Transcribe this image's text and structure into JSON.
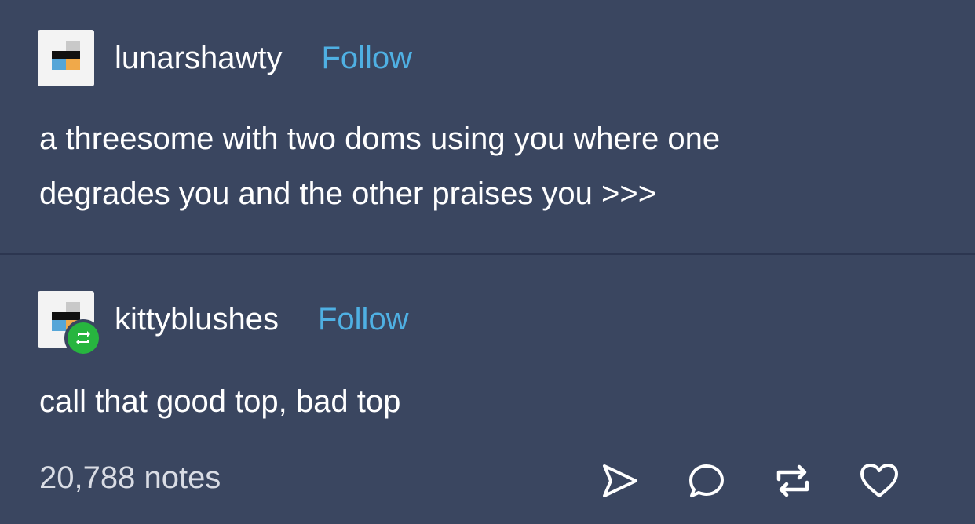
{
  "posts": [
    {
      "username": "lunarshawty",
      "follow_label": "Follow",
      "text_line1": "a threesome with two doms using you where one",
      "text_line2": "degrades you and the other praises you >>>"
    },
    {
      "username": "kittyblushes",
      "follow_label": "Follow",
      "text_line1": "call that good top, bad top",
      "reblogged": true
    }
  ],
  "footer": {
    "notes_label": "20,788 notes",
    "icons": [
      "share-icon",
      "reply-icon",
      "reblog-icon",
      "like-icon"
    ]
  },
  "colors": {
    "background": "#3a4660",
    "divider": "#2c3650",
    "follow": "#4fb0e3",
    "reblog_badge": "#27b53f"
  }
}
